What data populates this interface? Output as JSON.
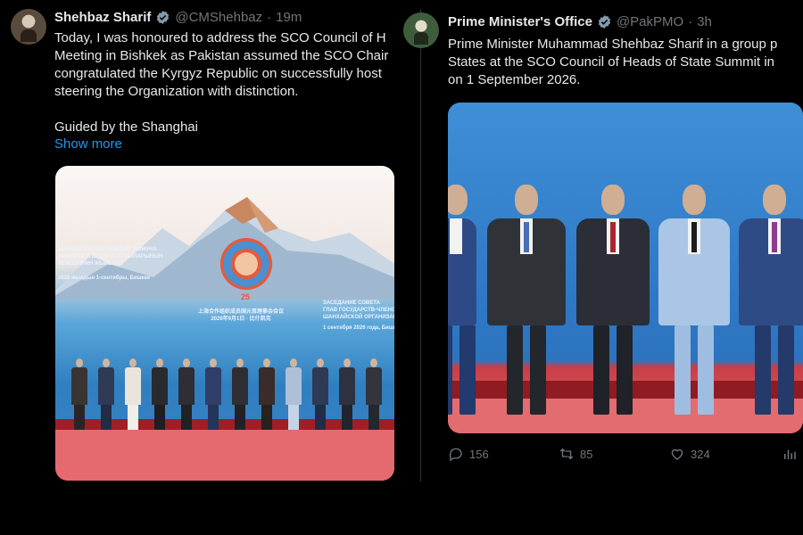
{
  "tweet_left": {
    "display_name": "Shehbaz Sharif",
    "handle": "@CMShehbaz",
    "dot": "·",
    "time": "19m",
    "lines": [
      "Today, I was honoured to address the SCO Council of H",
      "Meeting in Bishkek as Pakistan assumed the SCO Chair",
      "congratulated the Kyrgyz Republic on successfully host",
      "steering the Organization with distinction.",
      "Guided by the Shanghai"
    ],
    "show_more": "Show more",
    "image": {
      "banner_left": [
        "ШАНХАЙ КЫЗМАТТАШТЫК УЮМУНА",
        "МАМЛЕКЕТТЕРДИН БАШЧЫЛАРЫНЫН",
        "КЕҢЕШИНИН ЖЫЙЫНЫ",
        "2026-жылдын 1-сентябры, Бишкек"
      ],
      "banner_center": [
        "上海合作组织成员国元首理事会会议",
        "2026年9月1日 · 比什凯克"
      ],
      "banner_right": [
        "ЗАСЕДАНИЕ СОВЕТА",
        "ГЛАВ ГОСУДАРСТВ-ЧЛЕНОВ",
        "ШАНХАЙСКОЙ ОРГАНИЗАЦИИ",
        "1 сентября 2026 года, Бишкек"
      ],
      "emblem_number": "25"
    }
  },
  "tweet_right": {
    "display_name": "Prime Minister's Office",
    "handle": "@PakPMO",
    "dot": "·",
    "time": "3h",
    "lines": [
      "Prime Minister Muhammad Shehbaz Sharif in a group p",
      "States at the SCO Council of Heads of State Summit in",
      "on 1 September 2026."
    ],
    "actions": {
      "replies": "156",
      "reposts": "85",
      "likes": "324"
    }
  },
  "colors": {
    "background": "#000000",
    "text": "#e7e9ea",
    "muted": "#71767b",
    "link": "#1d9bf0",
    "verified": "#829aab"
  }
}
